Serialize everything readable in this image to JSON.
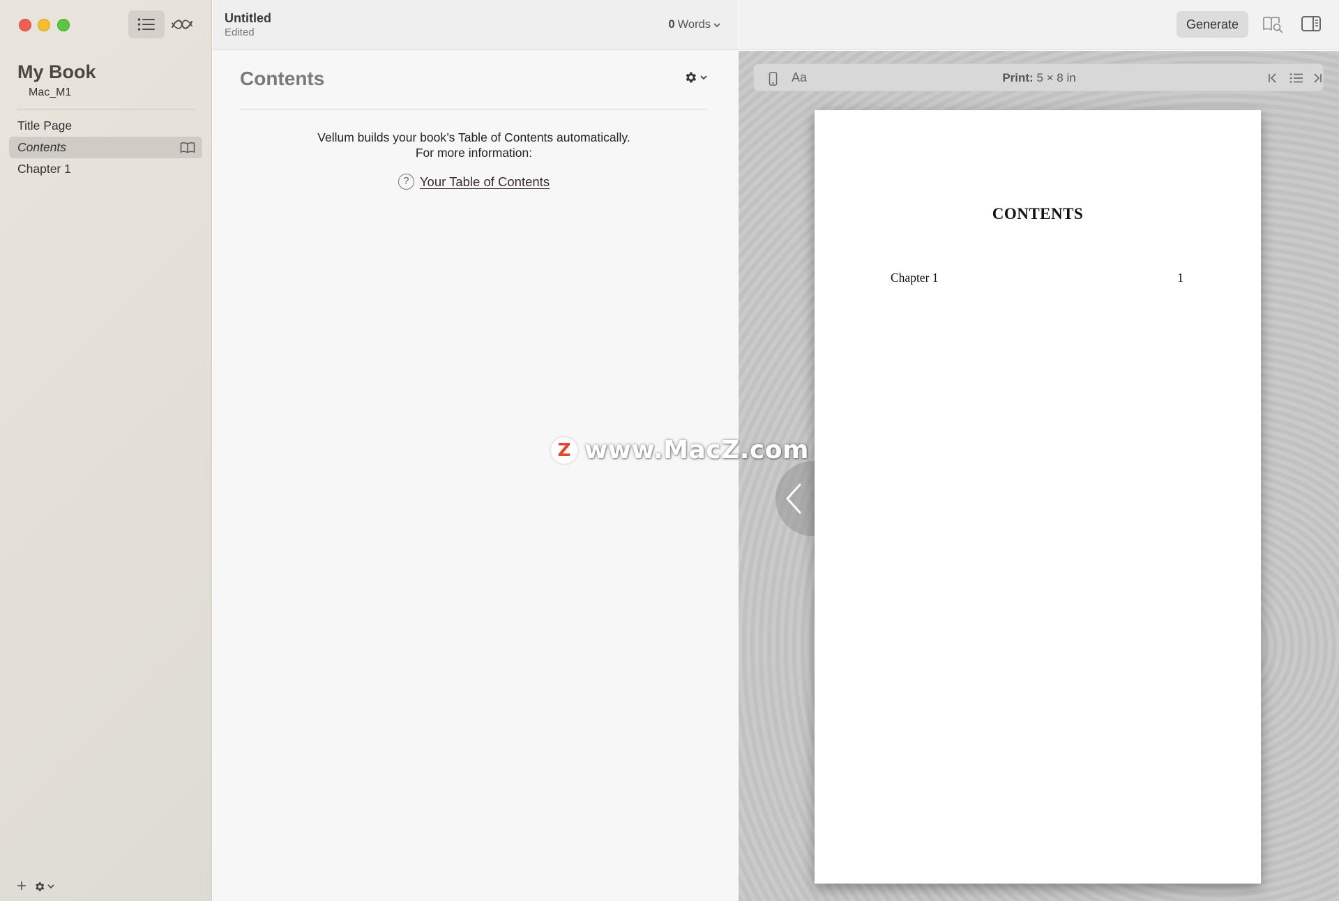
{
  "sidebar": {
    "book_title": "My Book",
    "author": "Mac_M1",
    "items": [
      {
        "label": "Title Page"
      },
      {
        "label": "Contents"
      },
      {
        "label": "Chapter 1"
      }
    ],
    "bottom": {
      "add_label": "+"
    }
  },
  "editor": {
    "doc_title": "Untitled",
    "doc_status": "Edited",
    "word_count": "0",
    "word_label": "Words",
    "section_heading": "Contents",
    "info_line1": "Vellum builds your book’s Table of Contents automatically.",
    "info_line2": "For more information:",
    "help_glyph": "?",
    "link_label": "Your Table of Contents"
  },
  "toolbar_right": {
    "generate_label": "Generate"
  },
  "preview": {
    "font_button": "Aa",
    "format_label": "Print:",
    "format_value": "5 × 8 in",
    "page_title": "CONTENTS",
    "toc_entries": [
      {
        "title": "Chapter 1",
        "page": "1"
      }
    ]
  },
  "watermark": {
    "logo_glyph": "Z",
    "text": "www.MacZ.com"
  },
  "colors": {
    "sidebar_bg": "#e6e2da",
    "selection": "#cfccc5",
    "preview_bg": "#c7c7c7",
    "link": "#3a2733",
    "watermark_logo": "#e2452a"
  }
}
